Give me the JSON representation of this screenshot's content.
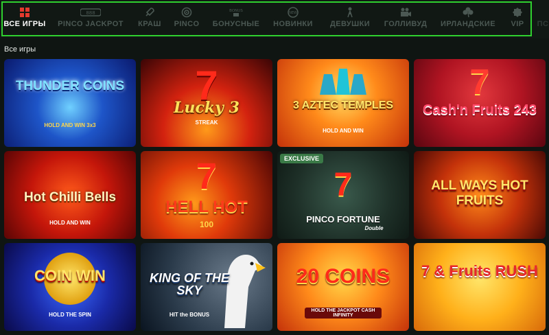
{
  "nav": {
    "items": [
      {
        "label": "ВСЕ ИГРЫ",
        "icon": "grid-icon"
      },
      {
        "label": "PINCO JACKPOT",
        "icon": "jackpot-icon"
      },
      {
        "label": "КРАШ",
        "icon": "rocket-icon"
      },
      {
        "label": "PINCO",
        "icon": "target-icon"
      },
      {
        "label": "БОНУСНЫЕ",
        "icon": "bonus-icon"
      },
      {
        "label": "НОВИНКИ",
        "icon": "new-icon"
      },
      {
        "label": "ДЕВУШКИ",
        "icon": "girl-icon"
      },
      {
        "label": "ГОЛЛИВУД",
        "icon": "camera-icon"
      },
      {
        "label": "ИРЛАНДСКИЕ",
        "icon": "clover-icon"
      },
      {
        "label": "VIP",
        "icon": "vip-icon"
      },
      {
        "label": "ПС",
        "icon": ""
      }
    ],
    "accent": "#2fd12f"
  },
  "section": {
    "title": "Все игры"
  },
  "games": [
    {
      "title": "THUNDER COINS",
      "sub": "HOLD AND WIN 3x3"
    },
    {
      "title": "Lucky 3",
      "sub": "STREAK"
    },
    {
      "title": "3 AZTEC TEMPLES",
      "sub": "HOLD AND WIN"
    },
    {
      "title": "Cash'n Fruits 243",
      "sub": ""
    },
    {
      "title": "Hot Chilli Bells",
      "sub": "HOLD AND WIN"
    },
    {
      "title": "HELL HOT",
      "sub": "100"
    },
    {
      "title": "PINCO FORTUNE",
      "sub": "Double",
      "badge": "EXCLUSIVE"
    },
    {
      "title": "ALL WAYS HOT FRUITS",
      "sub": ""
    },
    {
      "title": "COIN WIN",
      "sub": "HOLD THE SPIN"
    },
    {
      "title": "KING OF THE SKY",
      "sub": "HIT the BONUS"
    },
    {
      "title": "20 COINS",
      "sub": "HOLD THE JACKPOT CASH INFINITY"
    },
    {
      "title": "7 & Fruits RUSH",
      "sub": ""
    }
  ]
}
